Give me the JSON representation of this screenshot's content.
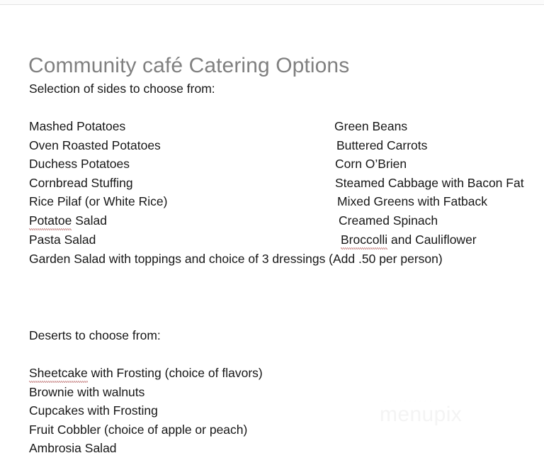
{
  "document": {
    "title": "Community café Catering Options",
    "sides_heading": "Selection of sides to choose from:",
    "desserts_heading": "Deserts to choose from:"
  },
  "sides": {
    "left_column": [
      {
        "text": "Mashed Potatoes"
      },
      {
        "text": "Oven Roasted Potatoes"
      },
      {
        "text": "Duchess Potatoes"
      },
      {
        "text": "Cornbread Stuffing"
      },
      {
        "text": "Rice Pilaf (or White Rice)"
      },
      {
        "misspelled": "Potatoe",
        "text": " Salad"
      },
      {
        "text": "Pasta Salad"
      }
    ],
    "right_column": [
      {
        "text": "Green Beans"
      },
      {
        "text": "Buttered Carrots"
      },
      {
        "text": "Corn O’Brien"
      },
      {
        "text": "Steamed Cabbage with Bacon Fat"
      },
      {
        "text": "Mixed Greens with Fatback"
      },
      {
        "text": "Creamed Spinach"
      },
      {
        "misspelled": "Broccolli",
        "text": " and Cauliflower"
      }
    ],
    "full_width_line": "Garden Salad with toppings and choice of 3 dressings (Add .50 per person)"
  },
  "desserts": [
    {
      "misspelled": "Sheetcake",
      "text": " with Frosting (choice of flavors)"
    },
    {
      "text": "Brownie with walnuts"
    },
    {
      "text": "Cupcakes with Frosting"
    },
    {
      "text": "Fruit Cobbler (choice of apple or peach)"
    },
    {
      "text": "Ambrosia Salad"
    }
  ],
  "watermark": {
    "top_text": "··········",
    "main_text": "menupix"
  },
  "colors": {
    "title": "#808080",
    "body": "#171717",
    "spellcheck_underline": "#9e2a2a",
    "watermark": "#f4f4f4",
    "page_background": "#ffffff"
  }
}
